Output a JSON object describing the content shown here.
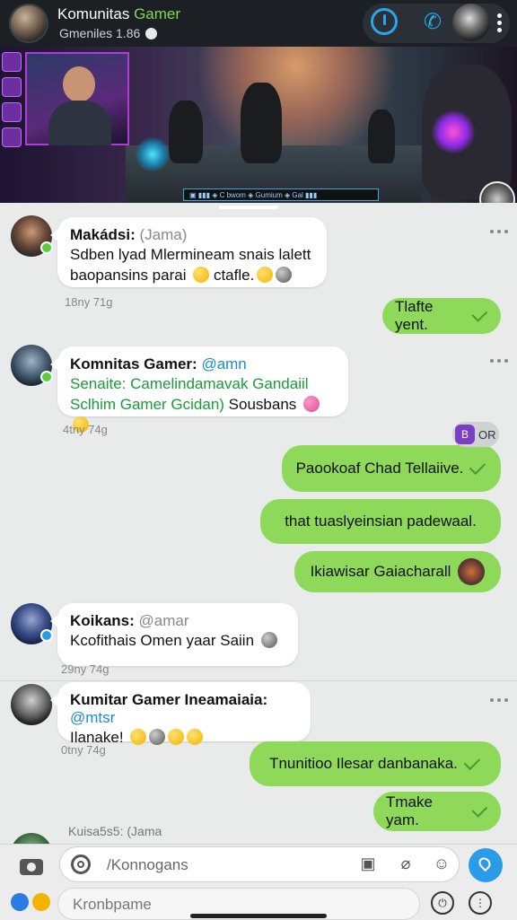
{
  "header": {
    "title_part1": "Komunitas",
    "title_part2": "Gamer",
    "subtitle": "Gmeniles 1.86",
    "icons": [
      "power-icon",
      "phone-icon",
      "avatar",
      "more-vertical-icon"
    ]
  },
  "banner": {
    "hud_text": "▣ ▮▮▮  ◈ C bwom   ◈ Gumium   ◈ Gal ▮▮▮"
  },
  "messages": [
    {
      "type": "in",
      "sender": "Makádsi:",
      "handle": "(Jama)",
      "line1": "Sdben lyad Mlermineam snais lalett",
      "line2": "baopansins parai",
      "line2_after": "ctafle.",
      "time": "18ny 71g"
    },
    {
      "type": "out",
      "text": "Tlafte yent."
    },
    {
      "type": "in",
      "sender": "Komnitas Gamer:",
      "handle": "@amn",
      "line1": "Senaite: Camelindamavak Gandaiil",
      "line2": "Sclhim Gamer Gcidan)",
      "line2_after": "Sousbans",
      "time": "4tny 74g"
    },
    {
      "type": "out",
      "text": "Paookoaf Chad Tellaiive."
    },
    {
      "type": "out",
      "text": "that tuaslyeinsian padewaal."
    },
    {
      "type": "out",
      "text": "Ikiawisar Gaiacharall"
    },
    {
      "type": "in",
      "sender": "Koikans:",
      "handle": "@amar",
      "line1": "Kcofithais Omen yaar Saiin",
      "time": "29ny 74g"
    },
    {
      "type": "in",
      "sender": "Kumitar Gamer Ineamaiaia:",
      "handle": "@mtsr",
      "line1": "Ilanake!",
      "time": "0tny 74g"
    },
    {
      "type": "out",
      "text": "Tnunitioo Ilesar danbanaka."
    },
    {
      "type": "out",
      "text": "Tmake yam."
    },
    {
      "type": "in_partial",
      "sender": "Kuisa5s5:",
      "handle": "(Jama"
    }
  ],
  "badge": {
    "letter": "B",
    "text": "OR"
  },
  "composer": {
    "placeholder": "/Konnogans",
    "second_placeholder": "Kronbpame"
  }
}
